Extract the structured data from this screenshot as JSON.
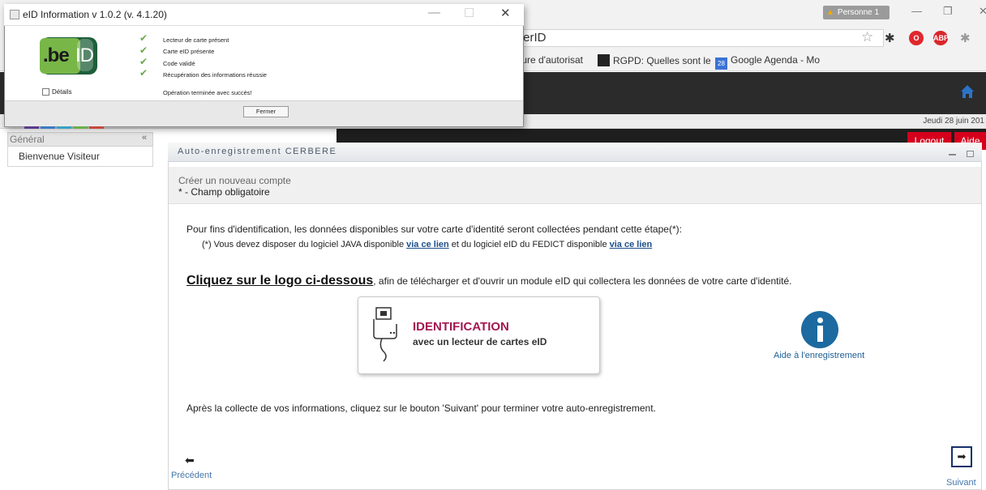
{
  "browser": {
    "profile_label": "Personne 1",
    "url_fragment": "terID",
    "bookmarks": [
      "ture d'autorisat",
      "RGPD: Quelles sont le",
      "Google Agenda - Mo"
    ],
    "calendar_day": "28",
    "extension_labels": [
      "ABP"
    ]
  },
  "header": {
    "date": "Jeudi 28 juin 201",
    "logout_label": "Logout",
    "help_label": "Aide"
  },
  "sidebar": {
    "section_label": "Général",
    "item_label": "Bienvenue Visiteur"
  },
  "panel": {
    "title": "Auto-enregistrement CERBERE",
    "section_title": "Créer un nouveau compte",
    "required_note": "* - Champ obligatoire",
    "intro": "Pour fins d'identification, les données disponibles sur votre carte d'identité seront collectées pendant cette étape(*):",
    "note_prefix": "(*) Vous devez disposer du logiciel JAVA disponible ",
    "note_link1": "via ce lien",
    "note_middle": " et du logiciel eID du FEDICT disponible ",
    "note_link2": "via ce lien",
    "cta_bold": "Cliquez sur le logo ci-dessous",
    "cta_rest": ", afin de télécharger et d'ouvrir un module eID qui collectera les données de votre carte d'identité.",
    "id_title": "IDENTIFICATION",
    "id_subtitle": "avec un lecteur de cartes eID",
    "help_link": "Aide à l'enregistrement",
    "after_note": "Après la collecte de vos informations, cliquez sur le bouton 'Suivant' pour terminer votre auto-enregistrement.",
    "prev_label": "Précédent",
    "next_label": "Suivant"
  },
  "dialog": {
    "title": "eID Information v 1.0.2 (v. 4.1.20)",
    "logo_text": ".be",
    "logo_text_id": "ID",
    "steps": [
      "Lecteur de carte présent",
      "Carte eID présente",
      "Code validé",
      "Récupération des informations réussie"
    ],
    "details_label": "Détails",
    "done_text": "Opération terminée avec succès!",
    "close_label": "Fermer"
  },
  "colors": {
    "brand_red": "#d6001c",
    "id_title": "#a3174f",
    "help_icon": "#1c6aa0",
    "check_green": "#6aa84f"
  }
}
